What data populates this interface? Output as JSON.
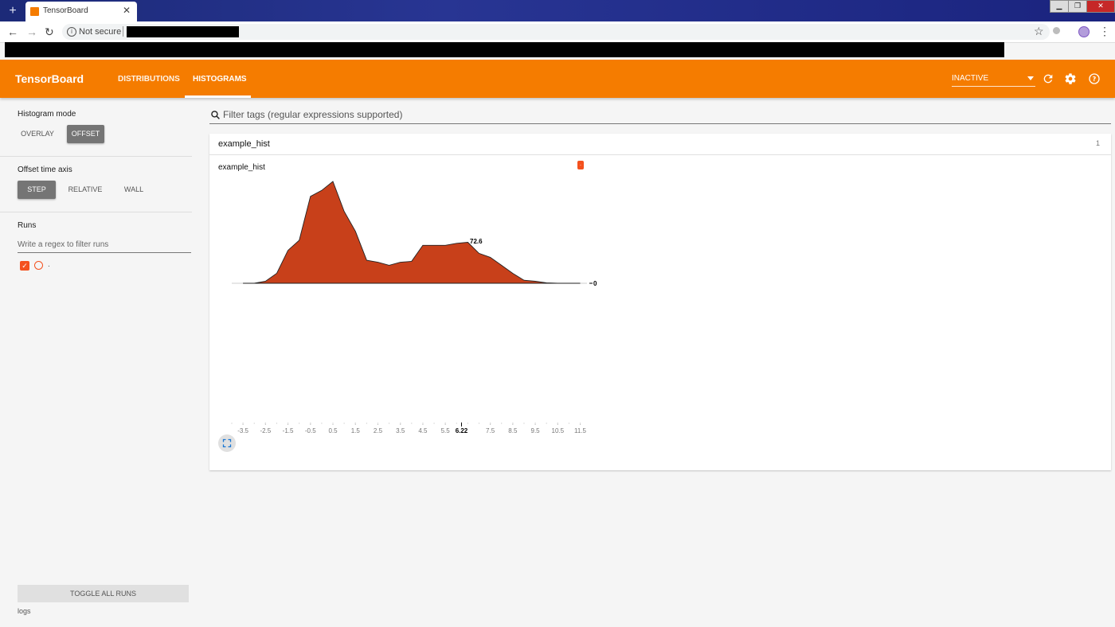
{
  "browser": {
    "tab_title": "TensorBoard",
    "tab_close": "✕",
    "new_tab": "+",
    "security_label": "Not secure",
    "window_controls": [
      "▁",
      "❐",
      "✕"
    ]
  },
  "header": {
    "brand": "TensorBoard",
    "tabs": [
      {
        "label": "DISTRIBUTIONS",
        "active": false
      },
      {
        "label": "HISTOGRAMS",
        "active": true
      }
    ],
    "status_select": "INACTIVE",
    "icons": [
      "refresh-icon",
      "settings-icon",
      "help-icon"
    ],
    "accent_color": "#f57c00"
  },
  "sidebar": {
    "histogram_mode_label": "Histogram mode",
    "histogram_modes": [
      {
        "label": "OVERLAY",
        "selected": false
      },
      {
        "label": "OFFSET",
        "selected": true
      }
    ],
    "time_axis_label": "Offset time axis",
    "time_axes": [
      {
        "label": "STEP",
        "selected": true
      },
      {
        "label": "RELATIVE",
        "selected": false
      },
      {
        "label": "WALL",
        "selected": false
      }
    ],
    "runs_label": "Runs",
    "runs_filter_placeholder": "Write a regex to filter runs",
    "runs": [
      {
        "name": ".",
        "checked": true,
        "color": "#f4511e"
      }
    ],
    "toggle_all_label": "TOGGLE ALL RUNS",
    "logdir": "logs"
  },
  "main": {
    "filter_placeholder": "Filter tags (regular expressions supported)",
    "category": {
      "title": "example_hist",
      "count": "1"
    },
    "card": {
      "title": "example_hist",
      "run_tag": "."
    }
  },
  "chart_data": {
    "type": "area",
    "fill_color": "#c8401a",
    "x": [
      -3.5,
      -3.0,
      -2.5,
      -2.0,
      -1.5,
      -1.0,
      -0.5,
      0.0,
      0.5,
      1.0,
      1.5,
      2.0,
      2.5,
      3.0,
      3.5,
      4.0,
      4.5,
      5.0,
      5.5,
      6.0,
      6.5,
      7.0,
      7.5,
      8.0,
      8.5,
      9.0,
      9.5,
      10.0,
      10.5,
      11.0,
      11.5
    ],
    "values": [
      0,
      0,
      2,
      10,
      33,
      43,
      87,
      93,
      102,
      72,
      52,
      23,
      21,
      18,
      21,
      22,
      38,
      38,
      38,
      40,
      41,
      30,
      26,
      18,
      10,
      3,
      2,
      0.5,
      0,
      0,
      0
    ],
    "xlim": [
      -4.0,
      11.8
    ],
    "ylim": [
      0,
      102
    ],
    "tick_labels": [
      "-3.5",
      "-2.5",
      "-1.5",
      "-0.5",
      "0.5",
      "1.5",
      "2.5",
      "3.5",
      "4.5",
      "5.5",
      "7.5",
      "8.5",
      "9.5",
      "10.5",
      "11.5"
    ],
    "hover": {
      "x": 6.22,
      "x_label": "6.22",
      "y_label": "72.6"
    },
    "offset_label": "0"
  }
}
